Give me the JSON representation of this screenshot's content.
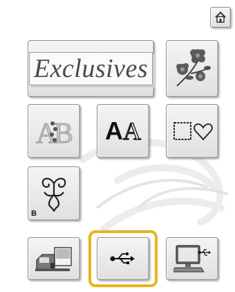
{
  "home": {
    "icon": "home-icon"
  },
  "categories": {
    "exclusives_label": "Exclusives",
    "flower_icon": "floral-embroidery-icon",
    "ab_icon": "floral-alphabet-icon",
    "font_label_bold": "A",
    "font_label_outline": "A",
    "frame_icon": "frames-shapes-icon",
    "b_label": "B",
    "b_icon": "ornament-icon"
  },
  "sources": {
    "machine_icon": "machine-memory-icon",
    "usb_icon": "usb-icon",
    "pc_icon": "computer-icon",
    "selected": "usb"
  },
  "colors": {
    "highlight": "#e5b51c",
    "button_face": "#e8e8e8",
    "icon_gray": "#555555"
  }
}
